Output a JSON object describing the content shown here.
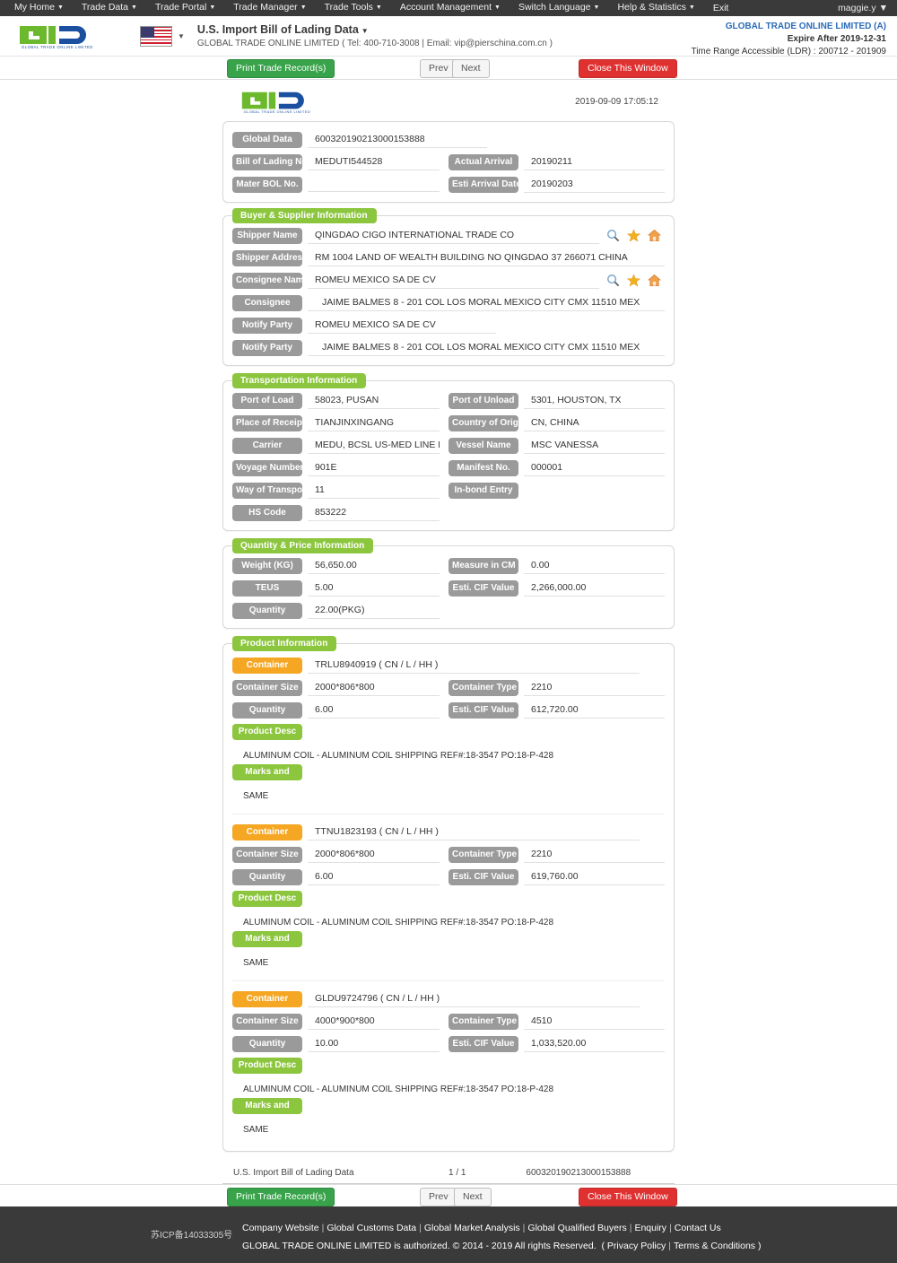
{
  "topnav": {
    "items": [
      {
        "label": "My Home",
        "caret": true
      },
      {
        "label": "Trade Data",
        "caret": true
      },
      {
        "label": "Trade Portal",
        "caret": true
      },
      {
        "label": "Trade Manager",
        "caret": true
      },
      {
        "label": "Trade Tools",
        "caret": true
      },
      {
        "label": "Account Management",
        "caret": true
      },
      {
        "label": "Switch Language",
        "caret": true
      },
      {
        "label": "Help & Statistics",
        "caret": true
      },
      {
        "label": "Exit",
        "caret": false
      }
    ],
    "user": "maggie.y"
  },
  "header": {
    "logo_text": "GLOBAL TRADE ONLINE LIMITED",
    "flag_alt": "us-flag",
    "title": "U.S. Import Bill of Lading Data",
    "subtitle": "GLOBAL TRADE ONLINE LIMITED ( Tel: 400-710-3008 | Email: vip@pierschina.com.cn )",
    "account_name": "GLOBAL TRADE ONLINE LIMITED (A)",
    "expire": "Expire After 2019-12-31",
    "time_range": "Time Range Accessible (LDR) : 200712 - 201909"
  },
  "toolbar": {
    "print_label": "Print Trade Record(s)",
    "prev_label": "Prev",
    "next_label": "Next",
    "close_label": "Close This Window"
  },
  "document": {
    "timestamp": "2019-09-09 17:05:12",
    "basic": {
      "global_data_label": "Global Data",
      "global_data_value": "600320190213000153888",
      "bol_label": "Bill of Lading No.",
      "bol_value": "MEDUTI544528",
      "actual_arrival_label": "Actual Arrival",
      "actual_arrival_value": "20190211",
      "master_bol_label": "Mater BOL No.",
      "master_bol_value": "",
      "esti_arrival_label": "Esti Arrival Date",
      "esti_arrival_value": "20190203"
    },
    "buyer_supplier": {
      "title": "Buyer & Supplier Information",
      "shipper_name_label": "Shipper Name",
      "shipper_name_value": "QINGDAO CIGO INTERNATIONAL TRADE CO",
      "shipper_address_label": "Shipper Address",
      "shipper_address_value": "RM 1004 LAND OF WEALTH BUILDING NO QINGDAO 37 266071 CHINA",
      "consignee_name_label": "Consignee Name",
      "consignee_name_value": "ROMEU MEXICO SA DE CV",
      "consignee_label": "Consignee",
      "consignee_value": "JAIME BALMES 8 - 201 COL LOS MORAL MEXICO CITY CMX 11510 MEX",
      "notify_party_label": "Notify Party",
      "notify_party_value": "ROMEU MEXICO SA DE CV",
      "notify_party2_label": "Notify Party",
      "notify_party2_value": "JAIME BALMES 8 - 201 COL LOS MORAL MEXICO CITY CMX 11510 MEX"
    },
    "transportation": {
      "title": "Transportation Information",
      "port_of_load_label": "Port of Load",
      "port_of_load_value": "58023, PUSAN",
      "port_of_unload_label": "Port of Unload",
      "port_of_unload_value": "5301, HOUSTON, TX",
      "place_of_receipt_label": "Place of Receipt",
      "place_of_receipt_value": "TIANJINXINGANG",
      "country_of_origin_label": "Country of Origin",
      "country_of_origin_value": "CN, CHINA",
      "carrier_label": "Carrier",
      "carrier_value": "MEDU, BCSL US-MED LINE LTD",
      "vessel_name_label": "Vessel Name",
      "vessel_name_value": "MSC VANESSA",
      "voyage_number_label": "Voyage Number",
      "voyage_number_value": "901E",
      "manifest_no_label": "Manifest No.",
      "manifest_no_value": "000001",
      "way_of_transport_label": "Way of Transport",
      "way_of_transport_value": "11",
      "inbond_entry_label": "In-bond Entry",
      "inbond_entry_value": "",
      "hs_code_label": "HS Code",
      "hs_code_value": "853222"
    },
    "quantity_price": {
      "title": "Quantity & Price Information",
      "weight_label": "Weight (KG)",
      "weight_value": "56,650.00",
      "measure_label": "Measure in CM",
      "measure_value": "0.00",
      "teus_label": "TEUS",
      "teus_value": "5.00",
      "cif_label": "Esti. CIF Value",
      "cif_value": "2,266,000.00",
      "quantity_label": "Quantity",
      "quantity_value": "22.00(PKG)"
    },
    "product": {
      "title": "Product Information",
      "container_label": "Container",
      "container_size_label": "Container Size",
      "container_type_label": "Container Type",
      "quantity_label": "Quantity",
      "cif_label": "Esti. CIF Value",
      "product_desc_label": "Product Desc",
      "marks_label": "Marks and",
      "items": [
        {
          "container": "TRLU8940919 ( CN / L / HH )",
          "size": "2000*806*800",
          "type": "2210",
          "quantity": "6.00",
          "cif": "612,720.00",
          "desc": "ALUMINUM COIL - ALUMINUM COIL SHIPPING REF#:18-3547 PO:18-P-428",
          "marks": "SAME"
        },
        {
          "container": "TTNU1823193 ( CN / L / HH )",
          "size": "2000*806*800",
          "type": "2210",
          "quantity": "6.00",
          "cif": "619,760.00",
          "desc": "ALUMINUM COIL - ALUMINUM COIL SHIPPING REF#:18-3547 PO:18-P-428",
          "marks": "SAME"
        },
        {
          "container": "GLDU9724796 ( CN / L / HH )",
          "size": "4000*900*800",
          "type": "4510",
          "quantity": "10.00",
          "cif": "1,033,520.00",
          "desc": "ALUMINUM COIL - ALUMINUM COIL SHIPPING REF#:18-3547 PO:18-P-428",
          "marks": "SAME"
        }
      ]
    },
    "footer": {
      "name": "U.S. Import Bill of Lading Data",
      "page": "1 / 1",
      "id": "600320190213000153888"
    }
  },
  "pagefooter": {
    "icp": "苏ICP备14033305号",
    "links": [
      "Company Website",
      "Global Customs Data",
      "Global Market Analysis",
      "Global Qualified Buyers",
      "Enquiry",
      "Contact Us"
    ],
    "copyright": "GLOBAL TRADE ONLINE LIMITED is authorized. © 2014 - 2019 All rights Reserved.",
    "privacy": "Privacy Policy",
    "terms": "Terms & Conditions"
  },
  "colors": {
    "nav_bg": "#3a3a3a",
    "green": "#8cc63e",
    "orange": "#f5a623",
    "gray_label": "#9a9a9a",
    "accent_blue": "#2b6cb8",
    "btn_green": "#38a34a",
    "btn_red": "#e03131"
  }
}
